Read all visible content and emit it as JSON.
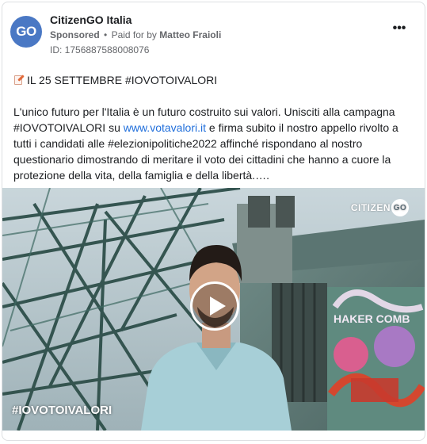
{
  "post": {
    "page_name": "CitizenGO Italia",
    "avatar_text": "GO",
    "sponsored_label": "Sponsored",
    "separator": "•",
    "paid_for_label": "Paid for by",
    "payer": "Matteo Fraioli",
    "ad_id": "ID: 1756887588008076",
    "more_icon": "•••",
    "headline": "IL 25 SETTEMBRE #IOVOTOIVALORI",
    "body_before_link": "L'unico futuro per l'Italia è un futuro costruito sui valori. Unisciti alla campagna #IOVOTOIVALORI su ",
    "body_link": "www.votavalori.it",
    "body_after_link": " e firma subito il nostro appello rivolto a tutti i candidati alle #elezionipolitiche2022 affinché rispondano al nostro questionario dimostrando di meritare il voto dei cittadini che hanno a cuore la protezione della vita, della famiglia e della libertà.…."
  },
  "video": {
    "watermark_text": "CITIZEN",
    "watermark_go": "GO",
    "hashtag": "#IOVOTOIVALORI",
    "graffiti_text": "HAKER COMB"
  },
  "colors": {
    "avatar": "#4a78c4",
    "link": "#216fdb",
    "secondary_text": "#65676b"
  }
}
